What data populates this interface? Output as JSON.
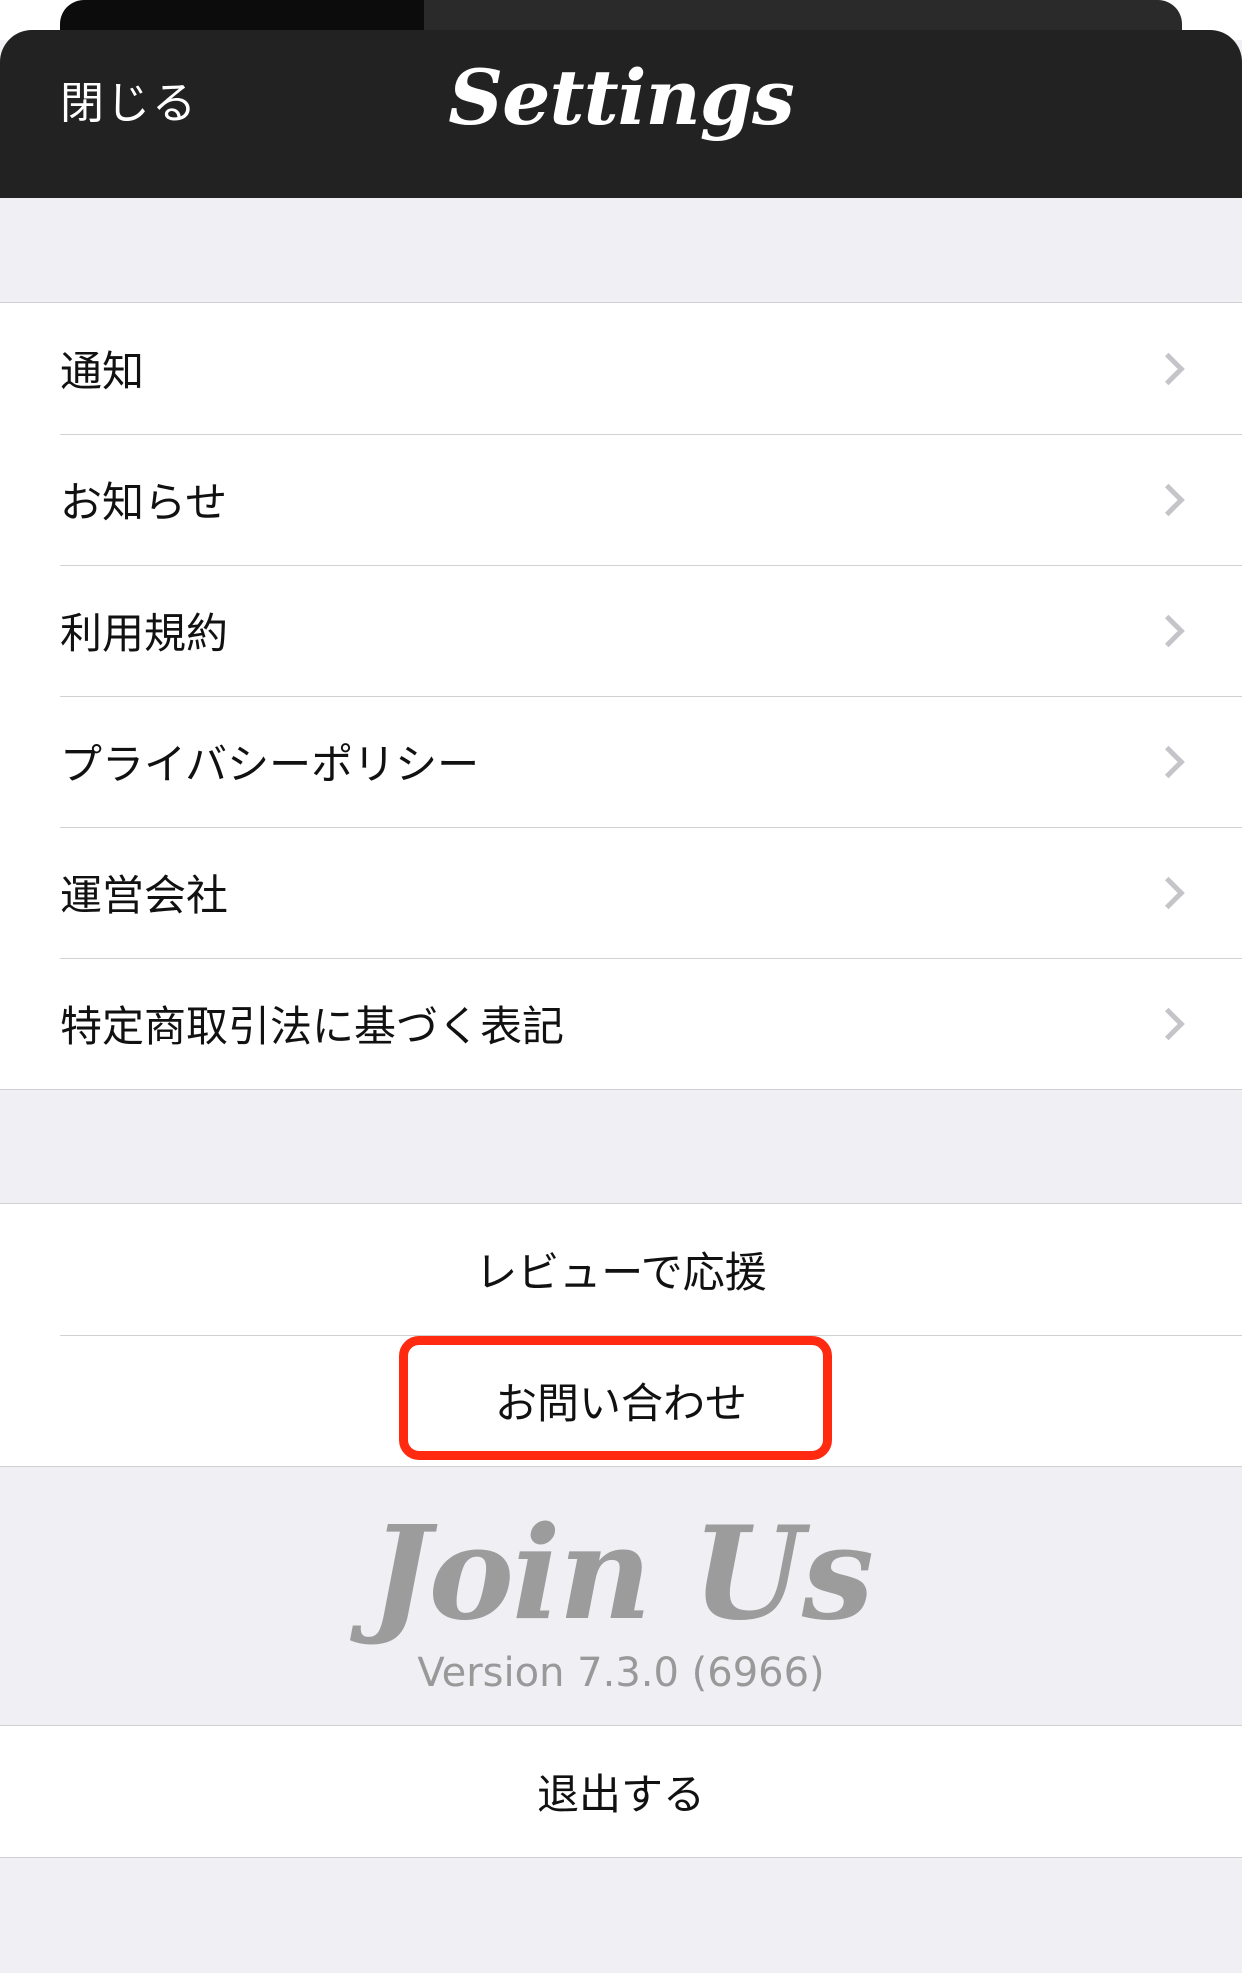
{
  "nav": {
    "close_label": "閉じる",
    "title": "Settings"
  },
  "menu_items": [
    {
      "label": "通知"
    },
    {
      "label": "お知らせ"
    },
    {
      "label": "利用規約"
    },
    {
      "label": "プライバシーポリシー"
    },
    {
      "label": "運営会社"
    },
    {
      "label": "特定商取引法に基づく表記"
    }
  ],
  "actions": {
    "review_label": "レビューで応援",
    "contact_label": "お問い合わせ"
  },
  "footer": {
    "brand": "Join Us",
    "version": "Version 7.3.0 (6966)"
  },
  "logout": {
    "label": "退出する"
  },
  "colors": {
    "nav_background": "#222222",
    "page_background": "#efeff4",
    "highlight": "#ff2a10"
  }
}
